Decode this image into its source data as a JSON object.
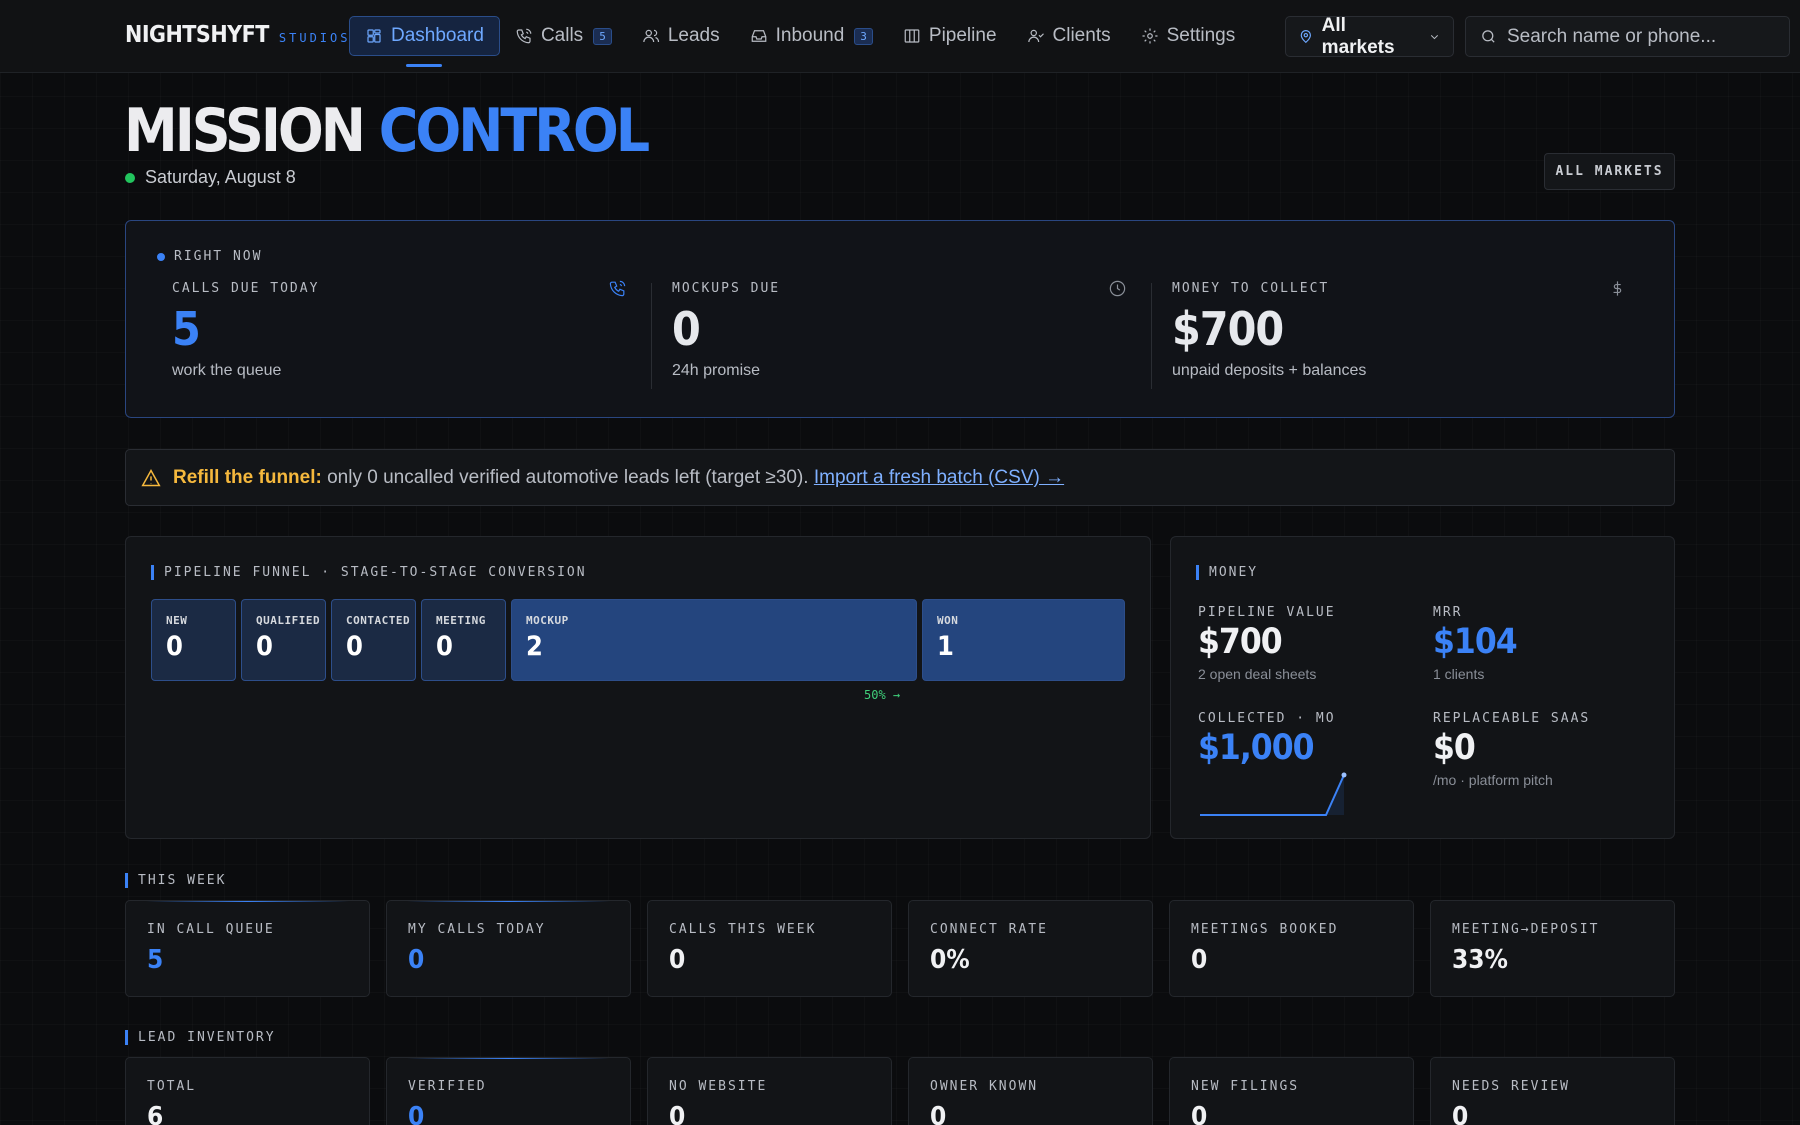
{
  "brand": {
    "name": "NIGHTSHYFT",
    "sub": "STUDIOS"
  },
  "nav": {
    "items": [
      {
        "label": "Dashboard",
        "icon": "dashboard-icon",
        "active": true,
        "badge": ""
      },
      {
        "label": "Calls",
        "icon": "phone-icon",
        "active": false,
        "badge": "5"
      },
      {
        "label": "Leads",
        "icon": "users-icon",
        "active": false,
        "badge": ""
      },
      {
        "label": "Inbound",
        "icon": "inbox-icon",
        "active": false,
        "badge": "3"
      },
      {
        "label": "Pipeline",
        "icon": "columns-icon",
        "active": false,
        "badge": ""
      },
      {
        "label": "Clients",
        "icon": "user-check-icon",
        "active": false,
        "badge": ""
      },
      {
        "label": "Settings",
        "icon": "gear-icon",
        "active": false,
        "badge": ""
      }
    ],
    "market_select": "All markets",
    "search_placeholder": "Search name or phone..."
  },
  "header": {
    "title_main": "MISSION",
    "title_accent": "CONTROL",
    "date": "Saturday, August 8",
    "all_markets_button": "ALL MARKETS"
  },
  "right_now": {
    "label": "RIGHT NOW",
    "items": [
      {
        "label": "CALLS DUE TODAY",
        "value": "5",
        "sub": "work the queue",
        "icon": "phone-icon",
        "color": "#3b82f6"
      },
      {
        "label": "MOCKUPS DUE",
        "value": "0",
        "sub": "24h promise",
        "icon": "clock-icon",
        "color": "#ffffff"
      },
      {
        "label": "MONEY TO COLLECT",
        "value": "$700",
        "sub": "unpaid deposits + balances",
        "icon": "dollar-icon",
        "color": "#ffffff"
      }
    ]
  },
  "alert": {
    "warn": "Refill the funnel:",
    "text": "only 0 uncalled verified automotive leads left (target ≥30).",
    "link": "Import a fresh batch (CSV) →"
  },
  "pipeline": {
    "title": "PIPELINE FUNNEL · STAGE-TO-STAGE CONVERSION",
    "stages": [
      {
        "label": "NEW",
        "value": "0",
        "share": 0
      },
      {
        "label": "QUALIFIED",
        "value": "0",
        "share": 0
      },
      {
        "label": "CONTACTED",
        "value": "0",
        "share": 0
      },
      {
        "label": "MEETING",
        "value": "0",
        "share": 0
      },
      {
        "label": "MOCKUP",
        "value": "2",
        "share": 2
      },
      {
        "label": "WON",
        "value": "1",
        "share": 1
      }
    ],
    "conversion": "50% →"
  },
  "money": {
    "title": "MONEY",
    "pipeline_value": {
      "label": "PIPELINE VALUE",
      "value": "$700",
      "sub": "2 open deal sheets"
    },
    "mrr": {
      "label": "MRR",
      "value": "$104",
      "sub": "1 clients"
    },
    "collected": {
      "label": "COLLECTED · MO",
      "value": "$1,000"
    },
    "replaceable": {
      "label": "REPLACEABLE SAAS",
      "value": "$0",
      "sub": "/mo · platform pitch"
    },
    "sparkline": [
      0,
      0,
      0,
      0,
      0,
      0,
      0,
      0,
      1000
    ]
  },
  "this_week": {
    "title": "THIS WEEK",
    "cards": [
      {
        "label": "IN CALL QUEUE",
        "value": "5",
        "blue": true,
        "glow": true
      },
      {
        "label": "MY CALLS TODAY",
        "value": "0",
        "blue": true,
        "glow": true
      },
      {
        "label": "CALLS THIS WEEK",
        "value": "0",
        "blue": false,
        "glow": false
      },
      {
        "label": "CONNECT RATE",
        "value": "0%",
        "blue": false,
        "glow": false
      },
      {
        "label": "MEETINGS BOOKED",
        "value": "0",
        "blue": false,
        "glow": false
      },
      {
        "label": "MEETING→DEPOSIT",
        "value": "33%",
        "blue": false,
        "glow": false
      }
    ]
  },
  "lead_inventory": {
    "title": "LEAD INVENTORY",
    "cards": [
      {
        "label": "TOTAL",
        "value": "6",
        "blue": false,
        "glow": false
      },
      {
        "label": "VERIFIED",
        "value": "0",
        "blue": true,
        "glow": true
      },
      {
        "label": "NO WEBSITE",
        "value": "0",
        "blue": false,
        "glow": false
      },
      {
        "label": "OWNER KNOWN",
        "value": "0",
        "blue": false,
        "glow": false
      },
      {
        "label": "NEW FILINGS",
        "value": "0",
        "blue": false,
        "glow": false
      },
      {
        "label": "NEEDS REVIEW",
        "value": "0",
        "blue": false,
        "glow": false
      }
    ]
  }
}
